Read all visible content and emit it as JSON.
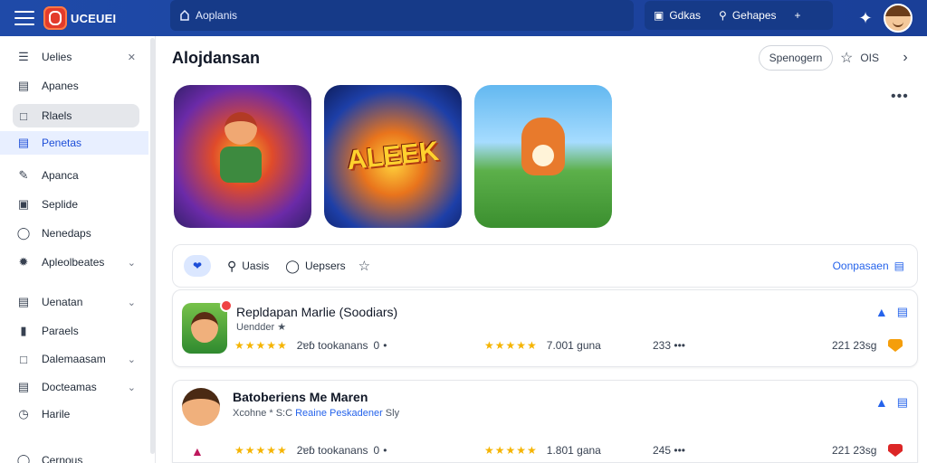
{
  "app": {
    "brand_name": "UCEUEI",
    "search_placeholder": "Aoplanis"
  },
  "topbar": {
    "action_1_label": "Gdkas",
    "action_2_label": "Gehapes",
    "add_label": "+"
  },
  "sidebar": {
    "items": [
      {
        "label": "Uelies",
        "icon": "list-icon"
      },
      {
        "label": "Apanes",
        "icon": "chart-icon"
      },
      {
        "label": "Rlaels",
        "icon": "box-icon"
      },
      {
        "label": "Penetas",
        "icon": "stack-icon"
      },
      {
        "label": "Apanca",
        "icon": "edit-icon"
      },
      {
        "label": "Seplide",
        "icon": "bag-icon"
      },
      {
        "label": "Nenedaps",
        "icon": "shield-icon"
      },
      {
        "label": "Apleolbeates",
        "icon": "gear-icon"
      },
      {
        "label": "Uenatan",
        "icon": "layers-icon"
      },
      {
        "label": "Paraels",
        "icon": "book-icon"
      },
      {
        "label": "Dalemaasam",
        "icon": "inbox-icon"
      },
      {
        "label": "Docteamas",
        "icon": "folder-icon"
      },
      {
        "label": "Harile",
        "icon": "clock-icon"
      },
      {
        "label": "Cernous",
        "icon": "tag-icon"
      }
    ]
  },
  "main": {
    "title": "Alojdansan",
    "sort_label": "Spenogern",
    "fav_label": "OIS",
    "tile2_text": "ALEEK",
    "filters": {
      "item_1": "Uasis",
      "item_2": "Uepsers",
      "right_label": "Oonpasaen"
    },
    "rows": [
      {
        "title": "Repldapan Marlie (Soodiars)",
        "subtitle": "Uendder",
        "rating_label": "2ɐɓ tookanans",
        "rating_value": "0",
        "rating2": "7.001 guna",
        "count": "233",
        "price": "221 23sg"
      },
      {
        "title": "Batoberiens Me Maren",
        "subtitle_prefix": "Xcohne * S:C",
        "subtitle_link": "Reaine Peskadener",
        "subtitle_suffix": "Sly",
        "rating_label": "2ɐɓ tookanans",
        "rating_value": "0",
        "rating2": "1.801 gana",
        "count": "245",
        "price": "221 23sg"
      }
    ]
  }
}
